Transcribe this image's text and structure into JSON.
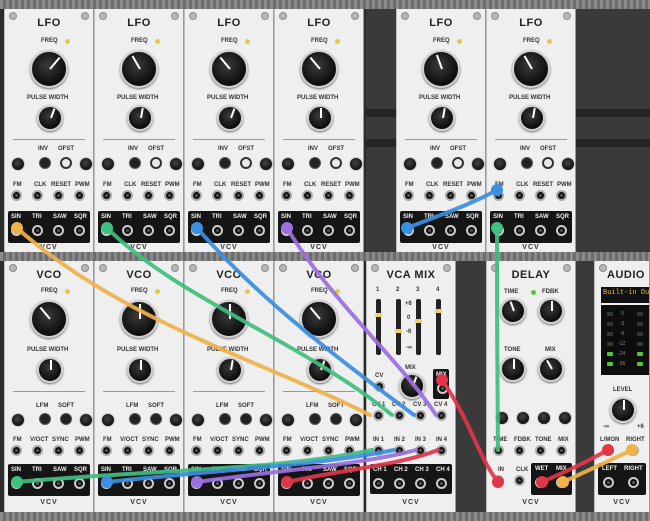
{
  "lfo": {
    "title": "LFO",
    "freq": "FREQ",
    "pulse_width": "PULSE WIDTH",
    "inv": "INV",
    "ofst": "OFST",
    "fm": "FM",
    "clk": "CLK",
    "reset": "RESET",
    "pwm": "PWM",
    "sin": "SIN",
    "tri": "TRI",
    "saw": "SAW",
    "sqr": "SQR",
    "brand": "VCV"
  },
  "vco": {
    "title": "VCO",
    "freq": "FREQ",
    "pulse_width": "PULSE WIDTH",
    "lfm": "LFM",
    "soft": "SOFT",
    "fm": "FM",
    "voct": "V/OCT",
    "sync": "SYNC",
    "pwm": "PWM",
    "sin": "SIN",
    "tri": "TRI",
    "saw": "SAW",
    "sqr": "SQR",
    "brand": "VCV"
  },
  "vcamix": {
    "title": "VCA MIX",
    "ch_numbers": [
      "1",
      "2",
      "3",
      "4"
    ],
    "scale": [
      "+6",
      "0",
      "-6",
      "-∞"
    ],
    "cv": "CV",
    "mix": "MIX",
    "mix_out": "MIX",
    "cv1": "CV 1",
    "cv2": "CV 2",
    "cv3": "CV 3",
    "cv4": "CV 4",
    "in1": "IN 1",
    "in2": "IN 2",
    "in3": "IN 3",
    "in4": "IN 4",
    "ch1": "CH 1",
    "ch2": "CH 2",
    "ch3": "CH 3",
    "ch4": "CH 4",
    "brand": "VCV"
  },
  "delay": {
    "title": "DELAY",
    "time": "TIME",
    "fdbk": "FDBK",
    "tone": "TONE",
    "mix": "MIX",
    "in_time": "TIME",
    "in_fdbk": "FDBK",
    "in_tone": "TONE",
    "in_mix": "MIX",
    "in": "IN",
    "clk": "CLK",
    "wet": "WET",
    "mix_out": "MIX",
    "brand": "VCV"
  },
  "audio": {
    "title": "AUDIO",
    "device": "Built-in Output",
    "vu_scale": [
      "0",
      "-3",
      "-6",
      "-12",
      "-24",
      "-36"
    ],
    "level": "LEVEL",
    "min": "-∞",
    "max": "+6",
    "lmon": "L/MON",
    "right": "RIGHT",
    "left": "LEFT",
    "right_out": "RIGHT",
    "brand": "VCV"
  },
  "colors": {
    "panel": "#efefef",
    "cable_orange": "#f0b24a",
    "cable_green": "#3fbf80",
    "cable_blue": "#3a8fe0",
    "cable_purple": "#9a6fe0",
    "cable_red": "#e0364a",
    "led_yellow": "#e8c640",
    "led_green": "#56c43a"
  }
}
